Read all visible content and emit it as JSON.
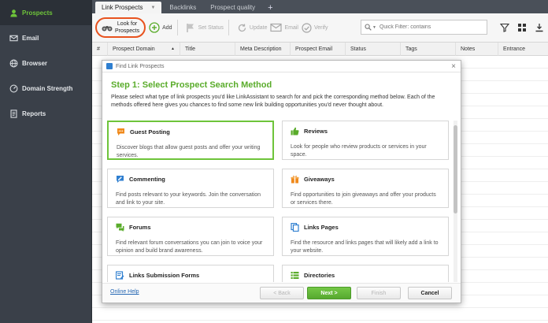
{
  "sidebar": {
    "items": [
      {
        "label": "Prospects",
        "icon": "user-icon",
        "active": true
      },
      {
        "label": "Email",
        "icon": "envelope-icon"
      },
      {
        "label": "Browser",
        "icon": "globe-icon"
      },
      {
        "label": "Domain Strength",
        "icon": "gauge-icon"
      },
      {
        "label": "Reports",
        "icon": "document-icon"
      }
    ]
  },
  "tabs": [
    {
      "label": "Link Prospects",
      "active": true
    },
    {
      "label": "Backlinks"
    },
    {
      "label": "Prospect quality"
    }
  ],
  "tab_add": "+",
  "toolbar": {
    "look_label_1": "Look for",
    "look_label_2": "Prospects",
    "add_label": "Add",
    "set_status_label": "Set Status",
    "update_label": "Update",
    "email_label": "Email",
    "verify_label": "Verify",
    "filter_placeholder": "Quick Filter: contains"
  },
  "columns": [
    "#",
    "Prospect Domain",
    "Title",
    "Meta Description",
    "Prospect Email",
    "Status",
    "Tags",
    "Notes",
    "Entrance"
  ],
  "dialog": {
    "window_title": "Find Link Prospects",
    "close": "×",
    "step_title": "Step 1: Select Prospect Search Method",
    "description": "Please select what type of link prospects you'd like LinkAssistant to search for and pick the corresponding method below. Each of the methods offered here gives you chances to find some new link building opportunities you'd never thought about.",
    "cards": [
      {
        "title": "Guest Posting",
        "desc": "Discover blogs that allow guest posts and offer your writing services.",
        "icon": "chat-bubble-icon",
        "selected": true
      },
      {
        "title": "Reviews",
        "desc": "Look for people who review products or services in your space.",
        "icon": "thumbs-up-icon"
      },
      {
        "title": "Commenting",
        "desc": "Find posts relevant to your keywords. Join the conversation and link to your site.",
        "icon": "comment-edit-icon"
      },
      {
        "title": "Giveaways",
        "desc": "Find opportunities to join giveaways and offer your products or services there.",
        "icon": "gift-icon"
      },
      {
        "title": "Forums",
        "desc": "Find relevant forum conversations you can join to voice your opinion and build brand awareness.",
        "icon": "forum-icon"
      },
      {
        "title": "Links Pages",
        "desc": "Find the resource and links pages that will likely add a link to your website.",
        "icon": "pages-icon"
      },
      {
        "title": "Links Submission Forms",
        "desc": "",
        "icon": "form-icon"
      },
      {
        "title": "Directories",
        "desc": "",
        "icon": "list-icon"
      }
    ],
    "footer": {
      "online_help": "Online Help",
      "back": "< Back",
      "next": "Next >",
      "finish": "Finish",
      "cancel": "Cancel"
    }
  },
  "colors": {
    "accent_green": "#6ec43a",
    "highlight_orange": "#e8531f",
    "sidebar_bg": "#3a4049",
    "link_blue": "#2466b3"
  }
}
